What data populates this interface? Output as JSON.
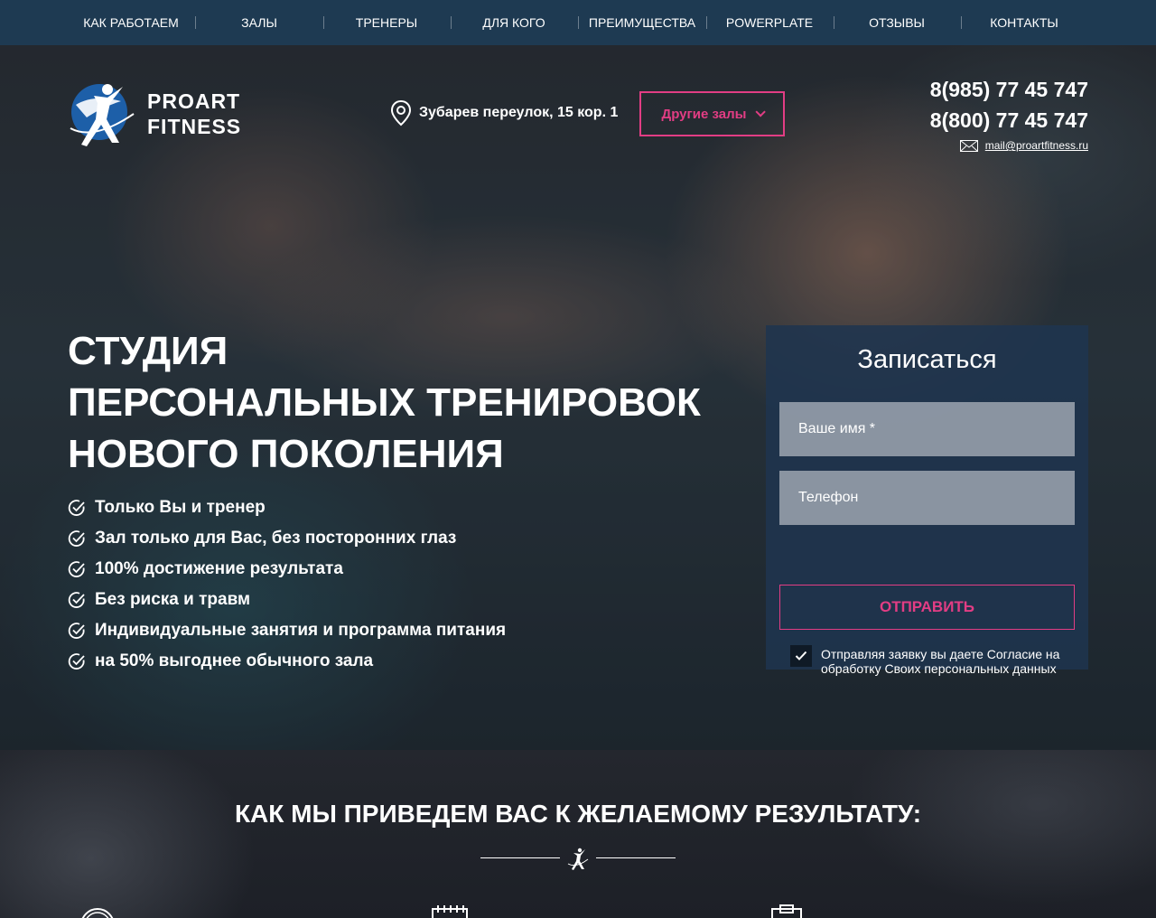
{
  "nav": {
    "items": [
      {
        "label": "Как работаем"
      },
      {
        "label": "Залы"
      },
      {
        "label": "Тренеры"
      },
      {
        "label": "Для кого"
      },
      {
        "label": "Преимущества"
      },
      {
        "label": "PowerPlate"
      },
      {
        "label": "Отзывы"
      },
      {
        "label": "Контакты"
      }
    ]
  },
  "header": {
    "logo_line1": "PROART",
    "logo_line2": "FITNESS",
    "address": "Зубарев переулок, 15 кор. 1",
    "halls_button": "Другие залы",
    "phone1": "8(985) 77 45 747",
    "phone2": "8(800) 77 45 747",
    "email": "mail@proartfitness.ru"
  },
  "hero": {
    "headline_line1": "Студия",
    "headline_line2": "персональных тренировок",
    "headline_line3": "нового поколения",
    "benefits": [
      "Только Вы и тренер",
      "Зал только для Вас, без посторонних глаз",
      "100% достижение результата",
      "Без риска и травм",
      "Индивидуальные занятия и программа питания",
      "на 50% выгоднее обычного зала"
    ]
  },
  "form": {
    "title": "Записаться",
    "name_placeholder": "Ваше имя *",
    "phone_placeholder": "Телефон",
    "submit_label": "Отправить",
    "consent_text": "Отправляя заявку вы даете Согласие на обработку Своих персональных данных",
    "consent_checked": true
  },
  "section2": {
    "title": "Как мы приведем вас к желаемому результату:"
  },
  "colors": {
    "nav_bg": "#1e3a52",
    "accent_pink": "#e23d84",
    "form_bg": "#1f344e",
    "logo_blue": "#1d5fa8"
  },
  "icons": [
    "location-pin-icon",
    "chevron-down-icon",
    "envelope-icon",
    "check-circle-icon",
    "checkmark-icon",
    "logo-figure-icon",
    "stopwatch-icon",
    "calendar-icon",
    "clipboard-icon"
  ]
}
